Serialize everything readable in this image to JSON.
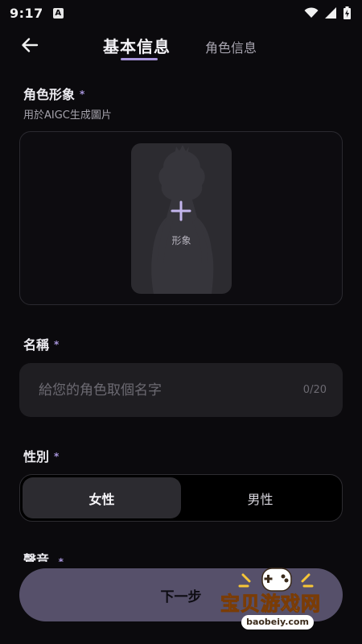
{
  "status_bar": {
    "time": "9:17",
    "a_badge": "A"
  },
  "header": {
    "tabs": [
      {
        "label": "基本信息",
        "active": true
      },
      {
        "label": "角色信息",
        "active": false
      }
    ]
  },
  "avatar": {
    "label": "角色形象",
    "required_mark": "*",
    "hint": "用於AIGC生成圖片",
    "card_label": "形象"
  },
  "name": {
    "label": "名稱",
    "required_mark": "*",
    "value": "",
    "placeholder": "給您的角色取個名字",
    "counter": "0/20"
  },
  "gender": {
    "label": "性別",
    "required_mark": "*",
    "options": [
      {
        "label": "女性",
        "selected": true
      },
      {
        "label": "男性",
        "selected": false
      }
    ]
  },
  "voice": {
    "label": "聲音",
    "required_mark": "*"
  },
  "next_button": {
    "label": "下一步"
  },
  "watermark": {
    "text": "宝贝游戏网",
    "url": "baobeiy.com"
  },
  "colors": {
    "background": "#0b0a0d",
    "accent": "#a996dc",
    "field_background": "#1f1e22",
    "button_background": "#56506a",
    "watermark_yellow": "#f6c637"
  }
}
